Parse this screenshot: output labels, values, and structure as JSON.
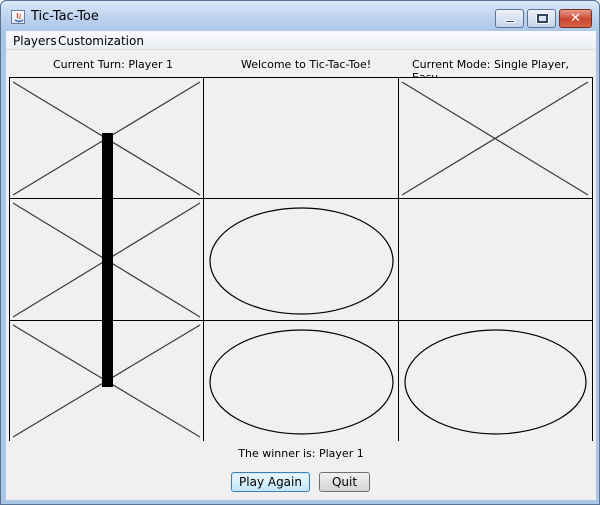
{
  "window": {
    "title": "Tic-Tac-Toe",
    "icons": [
      "java-app-icon",
      "minimize-icon",
      "maximize-icon",
      "close-icon"
    ]
  },
  "menubar": {
    "items": [
      "Players",
      "Customization"
    ]
  },
  "status": {
    "current_turn": "Current Turn: Player 1",
    "welcome": "Welcome to Tic-Tac-Toe!",
    "current_mode": "Current Mode: Single Player, Easy"
  },
  "board": {
    "rows": 3,
    "cols": 3,
    "cells": [
      [
        "X",
        "",
        "X"
      ],
      [
        "X",
        "O",
        ""
      ],
      [
        "X",
        "O",
        "O"
      ]
    ],
    "winning_line": "column-1"
  },
  "result": {
    "winner_text": "The winner is: Player 1"
  },
  "buttons": {
    "play_again": "Play Again",
    "quit": "Quit"
  }
}
